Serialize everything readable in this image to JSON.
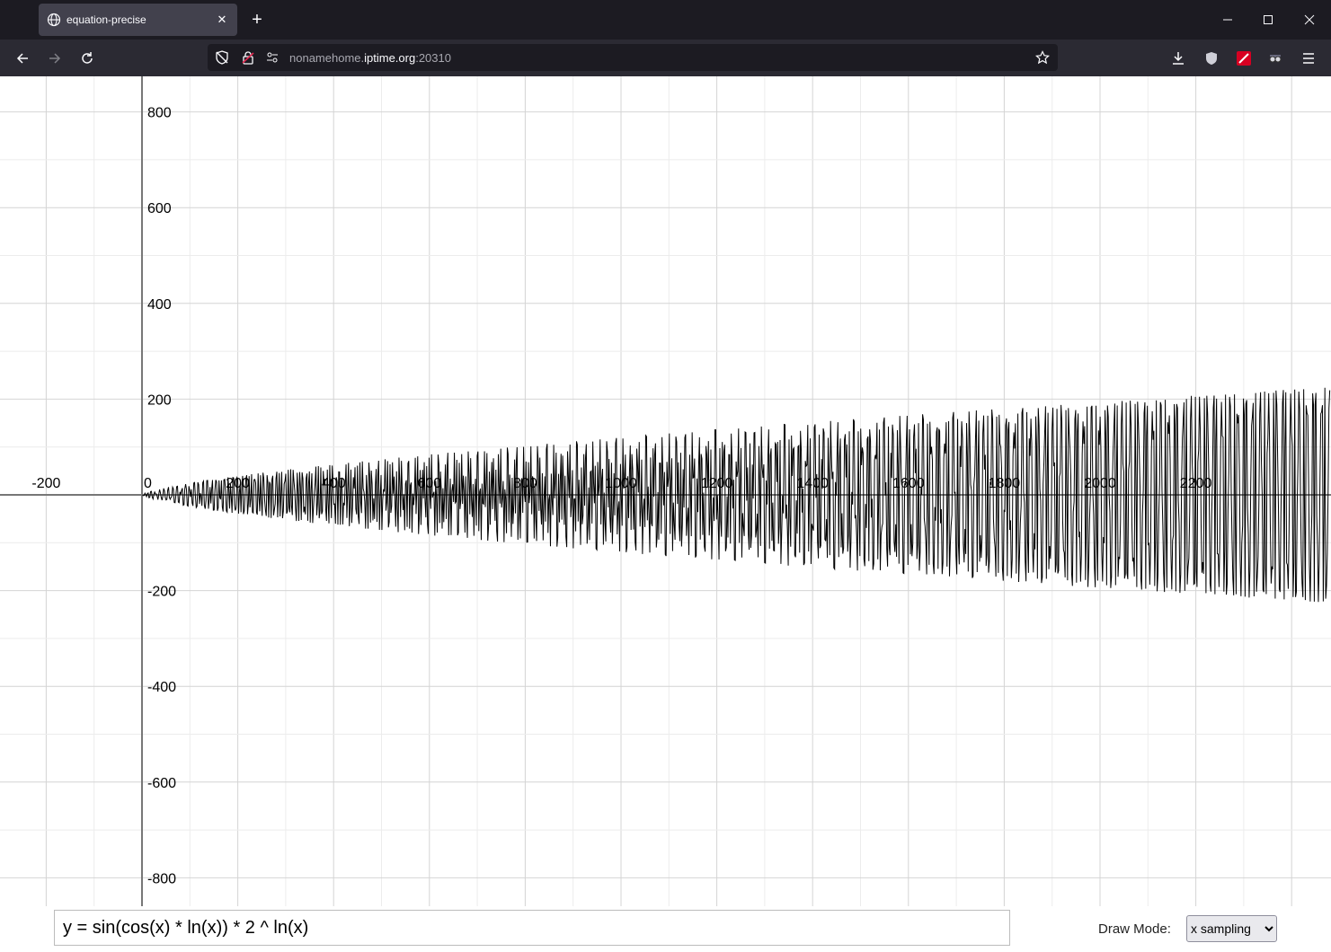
{
  "browser": {
    "tab_title": "equation-precise",
    "url_prefix": "nonamehome.",
    "url_host": "iptime.org",
    "url_port": ":20310"
  },
  "icons": {
    "tab": "globe-icon",
    "back": "arrow-left-icon",
    "forward": "arrow-right-icon",
    "reload": "reload-icon",
    "tracking": "shield-slash-icon",
    "lock": "lock-icon",
    "permissions": "sliders-icon",
    "bookmark": "star-icon",
    "downloads": "download-icon",
    "ext1": "shield-icon",
    "ext2": "red-extension-icon",
    "ext3": "mask-icon",
    "menu": "hamburger-icon"
  },
  "controls": {
    "equation": "y = sin(cos(x) * ln(x)) * 2 ^ ln(x)",
    "draw_mode_label": "Draw Mode:",
    "draw_mode_value": "x sampling"
  },
  "chart_data": {
    "type": "line",
    "equation": "y = sin(cos(x) * ln(x)) * 2 ^ ln(x)",
    "xlim": [
      -300,
      2480
    ],
    "ylim": [
      -860,
      870
    ],
    "grid": true,
    "x_ticks": [
      "-200",
      "0",
      "200",
      "400",
      "600",
      "800",
      "1000",
      "1200",
      "1400",
      "1600",
      "1800",
      "2000",
      "2200"
    ],
    "y_ticks": [
      "800",
      "600",
      "400",
      "200",
      "-200",
      "-400",
      "-600",
      "-800"
    ],
    "x_tick_values": [
      -200,
      0,
      200,
      400,
      600,
      800,
      1000,
      1200,
      1400,
      1600,
      1800,
      2000,
      2200
    ],
    "y_tick_values": [
      800,
      600,
      400,
      200,
      -200,
      -400,
      -600,
      -800
    ],
    "series": [
      {
        "function": "sin(cos(x)*ln(x))*2^ln(x)",
        "x_range": [
          1,
          2480
        ],
        "sample_step": 1.7,
        "color": "#000000"
      }
    ]
  }
}
